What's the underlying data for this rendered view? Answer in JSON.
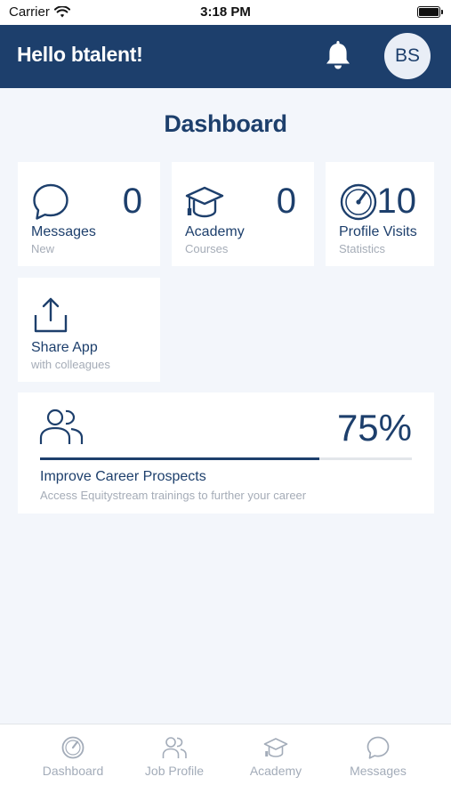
{
  "status_bar": {
    "carrier": "Carrier",
    "time": "3:18 PM",
    "icons": [
      "wifi-icon",
      "battery-icon"
    ]
  },
  "header": {
    "greeting": "Hello btalent!",
    "avatar_initials": "BS",
    "icons": [
      "bell-icon"
    ]
  },
  "page_title": "Dashboard",
  "tiles": [
    {
      "icon": "chat-bubble-icon",
      "count": "0",
      "label": "Messages",
      "sub": "New"
    },
    {
      "icon": "graduation-cap-icon",
      "count": "0",
      "label": "Academy",
      "sub": "Courses"
    },
    {
      "icon": "speedometer-icon",
      "count": "10",
      "label": "Profile Visits",
      "sub": "Statistics"
    },
    {
      "icon": "share-icon",
      "label": "Share App",
      "sub": "with colleagues"
    }
  ],
  "career": {
    "icon": "people-icon",
    "percent_text": "75%",
    "progress_fraction": 0.75,
    "label": "Improve Career Prospects",
    "sub": "Access Equitystream trainings to further your career"
  },
  "tabbar": {
    "tabs": [
      {
        "icon": "speedometer-icon",
        "label": "Dashboard"
      },
      {
        "icon": "people-icon",
        "label": "Job Profile"
      },
      {
        "icon": "graduation-cap-icon",
        "label": "Academy"
      },
      {
        "icon": "chat-bubble-icon",
        "label": "Messages"
      }
    ]
  },
  "colors": {
    "primary": "#1d3f6c",
    "background": "#f3f6fb",
    "muted_text": "#a5acb7",
    "tab_inactive": "#a3acb9"
  }
}
